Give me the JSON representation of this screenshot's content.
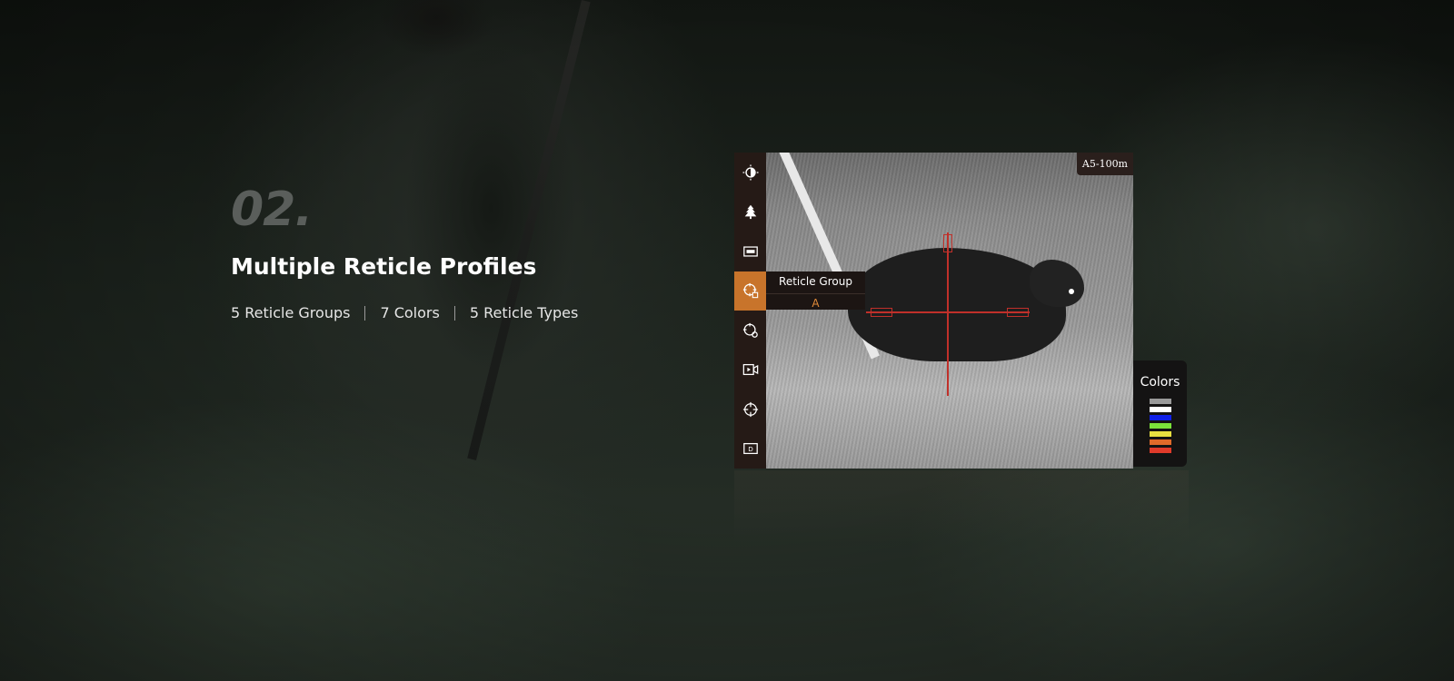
{
  "hero": {
    "step_number": "02.",
    "headline": "Multiple Reticle Profiles",
    "features": [
      "5 Reticle Groups",
      "7 Colors",
      "5 Reticle Types"
    ]
  },
  "device": {
    "zoom_badge": "A5-100m",
    "sidebar": [
      {
        "icon": "brightness-contrast-icon",
        "active": false
      },
      {
        "icon": "tree-icon",
        "active": false
      },
      {
        "icon": "screen-icon",
        "active": false
      },
      {
        "icon": "reticle-group-icon",
        "active": true
      },
      {
        "icon": "reticle-settings-icon",
        "active": false
      },
      {
        "icon": "video-record-icon",
        "active": false
      },
      {
        "icon": "crosshair-icon",
        "active": false
      },
      {
        "icon": "memory-card-icon",
        "active": false
      }
    ],
    "tooltip": {
      "title": "Reticle Group",
      "value": "A"
    },
    "colors_panel": {
      "title": "Colors",
      "swatches": [
        "#9a9a9a",
        "#ffffff",
        "#1020e8",
        "#7be23a",
        "#e8e040",
        "#e06a2a",
        "#e03a2a"
      ]
    },
    "accent_color": "#c8742b"
  }
}
